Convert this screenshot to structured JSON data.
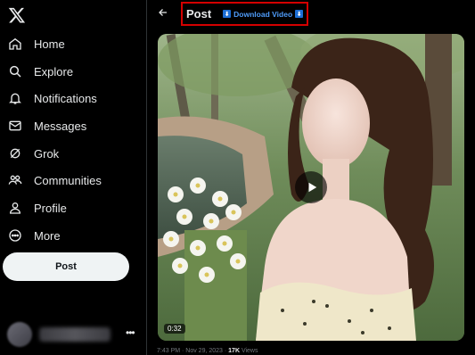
{
  "sidebar": {
    "logo": "x-logo-icon",
    "items": [
      {
        "label": "Home",
        "icon": "home-icon"
      },
      {
        "label": "Explore",
        "icon": "search-icon"
      },
      {
        "label": "Notifications",
        "icon": "bell-icon"
      },
      {
        "label": "Messages",
        "icon": "envelope-icon"
      },
      {
        "label": "Grok",
        "icon": "grok-icon"
      },
      {
        "label": "Communities",
        "icon": "people-icon"
      },
      {
        "label": "Profile",
        "icon": "person-icon"
      },
      {
        "label": "More",
        "icon": "more-circle-icon"
      }
    ],
    "post_button": "Post",
    "account_more": "•••"
  },
  "header": {
    "title": "Post",
    "download_label": "Download Video",
    "download_icon_char": "⬇"
  },
  "video": {
    "duration": "0:32",
    "play_icon": "play-icon"
  },
  "meta": {
    "time": "7:43 PM · Nov 29, 2023 · ",
    "views": "17K",
    "views_label": " Views"
  },
  "colors": {
    "background": "#000000",
    "text": "#e7e9ea",
    "accent": "#4f9cf9",
    "highlight_border": "#d40000",
    "post_button": "#eff3f4"
  }
}
